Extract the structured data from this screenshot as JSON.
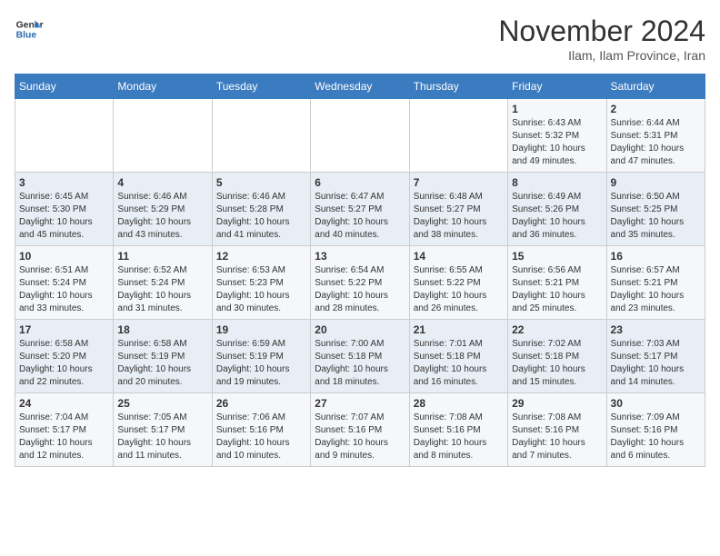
{
  "logo": {
    "line1": "General",
    "line2": "Blue"
  },
  "title": "November 2024",
  "location": "Ilam, Ilam Province, Iran",
  "weekdays": [
    "Sunday",
    "Monday",
    "Tuesday",
    "Wednesday",
    "Thursday",
    "Friday",
    "Saturday"
  ],
  "weeks": [
    [
      {
        "day": "",
        "info": ""
      },
      {
        "day": "",
        "info": ""
      },
      {
        "day": "",
        "info": ""
      },
      {
        "day": "",
        "info": ""
      },
      {
        "day": "",
        "info": ""
      },
      {
        "day": "1",
        "info": "Sunrise: 6:43 AM\nSunset: 5:32 PM\nDaylight: 10 hours\nand 49 minutes."
      },
      {
        "day": "2",
        "info": "Sunrise: 6:44 AM\nSunset: 5:31 PM\nDaylight: 10 hours\nand 47 minutes."
      }
    ],
    [
      {
        "day": "3",
        "info": "Sunrise: 6:45 AM\nSunset: 5:30 PM\nDaylight: 10 hours\nand 45 minutes."
      },
      {
        "day": "4",
        "info": "Sunrise: 6:46 AM\nSunset: 5:29 PM\nDaylight: 10 hours\nand 43 minutes."
      },
      {
        "day": "5",
        "info": "Sunrise: 6:46 AM\nSunset: 5:28 PM\nDaylight: 10 hours\nand 41 minutes."
      },
      {
        "day": "6",
        "info": "Sunrise: 6:47 AM\nSunset: 5:27 PM\nDaylight: 10 hours\nand 40 minutes."
      },
      {
        "day": "7",
        "info": "Sunrise: 6:48 AM\nSunset: 5:27 PM\nDaylight: 10 hours\nand 38 minutes."
      },
      {
        "day": "8",
        "info": "Sunrise: 6:49 AM\nSunset: 5:26 PM\nDaylight: 10 hours\nand 36 minutes."
      },
      {
        "day": "9",
        "info": "Sunrise: 6:50 AM\nSunset: 5:25 PM\nDaylight: 10 hours\nand 35 minutes."
      }
    ],
    [
      {
        "day": "10",
        "info": "Sunrise: 6:51 AM\nSunset: 5:24 PM\nDaylight: 10 hours\nand 33 minutes."
      },
      {
        "day": "11",
        "info": "Sunrise: 6:52 AM\nSunset: 5:24 PM\nDaylight: 10 hours\nand 31 minutes."
      },
      {
        "day": "12",
        "info": "Sunrise: 6:53 AM\nSunset: 5:23 PM\nDaylight: 10 hours\nand 30 minutes."
      },
      {
        "day": "13",
        "info": "Sunrise: 6:54 AM\nSunset: 5:22 PM\nDaylight: 10 hours\nand 28 minutes."
      },
      {
        "day": "14",
        "info": "Sunrise: 6:55 AM\nSunset: 5:22 PM\nDaylight: 10 hours\nand 26 minutes."
      },
      {
        "day": "15",
        "info": "Sunrise: 6:56 AM\nSunset: 5:21 PM\nDaylight: 10 hours\nand 25 minutes."
      },
      {
        "day": "16",
        "info": "Sunrise: 6:57 AM\nSunset: 5:21 PM\nDaylight: 10 hours\nand 23 minutes."
      }
    ],
    [
      {
        "day": "17",
        "info": "Sunrise: 6:58 AM\nSunset: 5:20 PM\nDaylight: 10 hours\nand 22 minutes."
      },
      {
        "day": "18",
        "info": "Sunrise: 6:58 AM\nSunset: 5:19 PM\nDaylight: 10 hours\nand 20 minutes."
      },
      {
        "day": "19",
        "info": "Sunrise: 6:59 AM\nSunset: 5:19 PM\nDaylight: 10 hours\nand 19 minutes."
      },
      {
        "day": "20",
        "info": "Sunrise: 7:00 AM\nSunset: 5:18 PM\nDaylight: 10 hours\nand 18 minutes."
      },
      {
        "day": "21",
        "info": "Sunrise: 7:01 AM\nSunset: 5:18 PM\nDaylight: 10 hours\nand 16 minutes."
      },
      {
        "day": "22",
        "info": "Sunrise: 7:02 AM\nSunset: 5:18 PM\nDaylight: 10 hours\nand 15 minutes."
      },
      {
        "day": "23",
        "info": "Sunrise: 7:03 AM\nSunset: 5:17 PM\nDaylight: 10 hours\nand 14 minutes."
      }
    ],
    [
      {
        "day": "24",
        "info": "Sunrise: 7:04 AM\nSunset: 5:17 PM\nDaylight: 10 hours\nand 12 minutes."
      },
      {
        "day": "25",
        "info": "Sunrise: 7:05 AM\nSunset: 5:17 PM\nDaylight: 10 hours\nand 11 minutes."
      },
      {
        "day": "26",
        "info": "Sunrise: 7:06 AM\nSunset: 5:16 PM\nDaylight: 10 hours\nand 10 minutes."
      },
      {
        "day": "27",
        "info": "Sunrise: 7:07 AM\nSunset: 5:16 PM\nDaylight: 10 hours\nand 9 minutes."
      },
      {
        "day": "28",
        "info": "Sunrise: 7:08 AM\nSunset: 5:16 PM\nDaylight: 10 hours\nand 8 minutes."
      },
      {
        "day": "29",
        "info": "Sunrise: 7:08 AM\nSunset: 5:16 PM\nDaylight: 10 hours\nand 7 minutes."
      },
      {
        "day": "30",
        "info": "Sunrise: 7:09 AM\nSunset: 5:16 PM\nDaylight: 10 hours\nand 6 minutes."
      }
    ]
  ]
}
